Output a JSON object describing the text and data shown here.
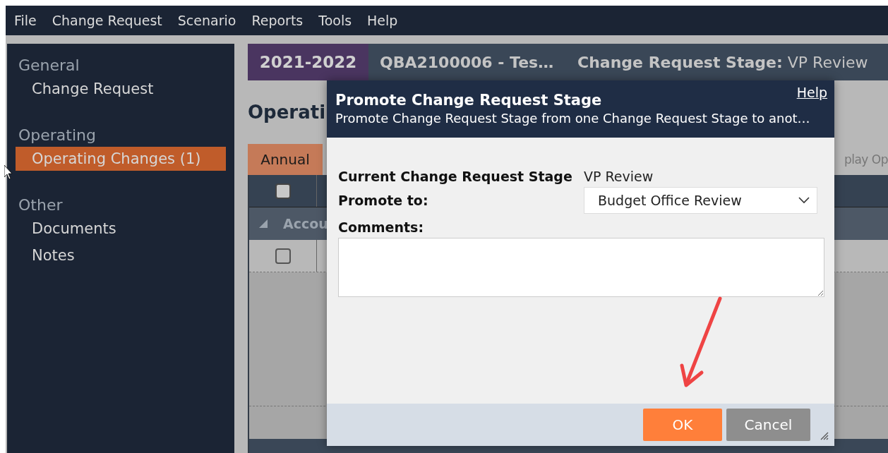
{
  "menu": [
    "File",
    "Change Request",
    "Scenario",
    "Reports",
    "Tools",
    "Help"
  ],
  "sidebar": {
    "sections": [
      {
        "heading": "General",
        "items": [
          {
            "label": "Change Request",
            "selected": false
          }
        ]
      },
      {
        "heading": "Operating",
        "items": [
          {
            "label": "Operating Changes (1)",
            "selected": true
          }
        ]
      },
      {
        "heading": "Other",
        "items": [
          {
            "label": "Documents",
            "selected": false
          },
          {
            "label": "Notes",
            "selected": false
          }
        ]
      }
    ]
  },
  "header": {
    "year": "2021-2022",
    "request": "QBA2100006 - Tes…",
    "stage_label": "Change Request Stage:",
    "stage_value": "VP Review"
  },
  "page_title": "Operati",
  "tabs": [
    {
      "label": "Annual",
      "selected": true
    }
  ],
  "display_options": "play Op",
  "grid": {
    "header_checkbox": {
      "checked": false
    },
    "group": "Accou",
    "rows": [
      {
        "checked": false
      }
    ]
  },
  "dialog": {
    "title": "Promote Change Request Stage",
    "subtitle": "Promote Change Request Stage from one Change Request Stage to anot…",
    "help": "Help",
    "current_label": "Current Change Request Stage",
    "current_value": "VP Review",
    "promote_label": "Promote to:",
    "promote_value": "Budget Office Review",
    "comments_label": "Comments:",
    "buttons": [
      {
        "label": "OK",
        "kind": "primary"
      },
      {
        "label": "Cancel",
        "kind": "secondary"
      }
    ]
  }
}
